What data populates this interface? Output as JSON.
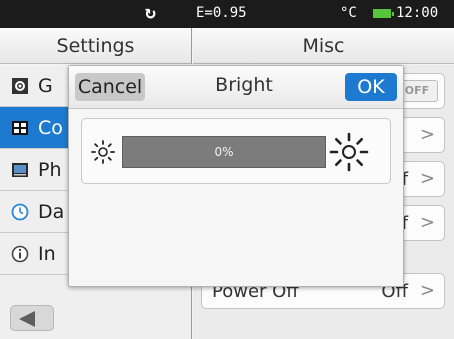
{
  "status_bar": {
    "emissivity": "E=0.95",
    "unit": "°C",
    "time": "12:00",
    "icons": {
      "refresh": "refresh-icon",
      "battery": "battery-icon"
    },
    "battery_color": "#57c43b"
  },
  "left_panel": {
    "title": "Settings",
    "items": [
      {
        "label": "G",
        "icon": "gear-icon"
      },
      {
        "label": "Co",
        "icon": "color-palette-icon",
        "active": true
      },
      {
        "label": "Ph",
        "icon": "photo-icon"
      },
      {
        "label": "Da",
        "icon": "clock-icon"
      },
      {
        "label": "In",
        "icon": "info-icon"
      }
    ],
    "back_icon": "back-arrow-icon"
  },
  "right_panel": {
    "title": "Misc",
    "rows": [
      {
        "label": "",
        "value": "",
        "toggle": "OFF"
      },
      {
        "label": "",
        "value": "",
        "chevron": ">"
      },
      {
        "label": "",
        "value": "ff",
        "chevron": ">"
      },
      {
        "label": "",
        "value": "ff",
        "chevron": ">"
      },
      {
        "label": "Power Off",
        "value": "Off",
        "chevron": ">"
      }
    ]
  },
  "dialog": {
    "cancel_label": "Cancel",
    "title": "Bright",
    "ok_label": "OK",
    "slider": {
      "value_text": "0%",
      "value_fraction": 0.0,
      "min_icon": "brightness-low-icon",
      "max_icon": "brightness-high-icon"
    }
  },
  "colors": {
    "accent": "#1e7ad0",
    "status_bar_bg": "#1b1b1b",
    "slider_track": "#7c7c7c"
  }
}
